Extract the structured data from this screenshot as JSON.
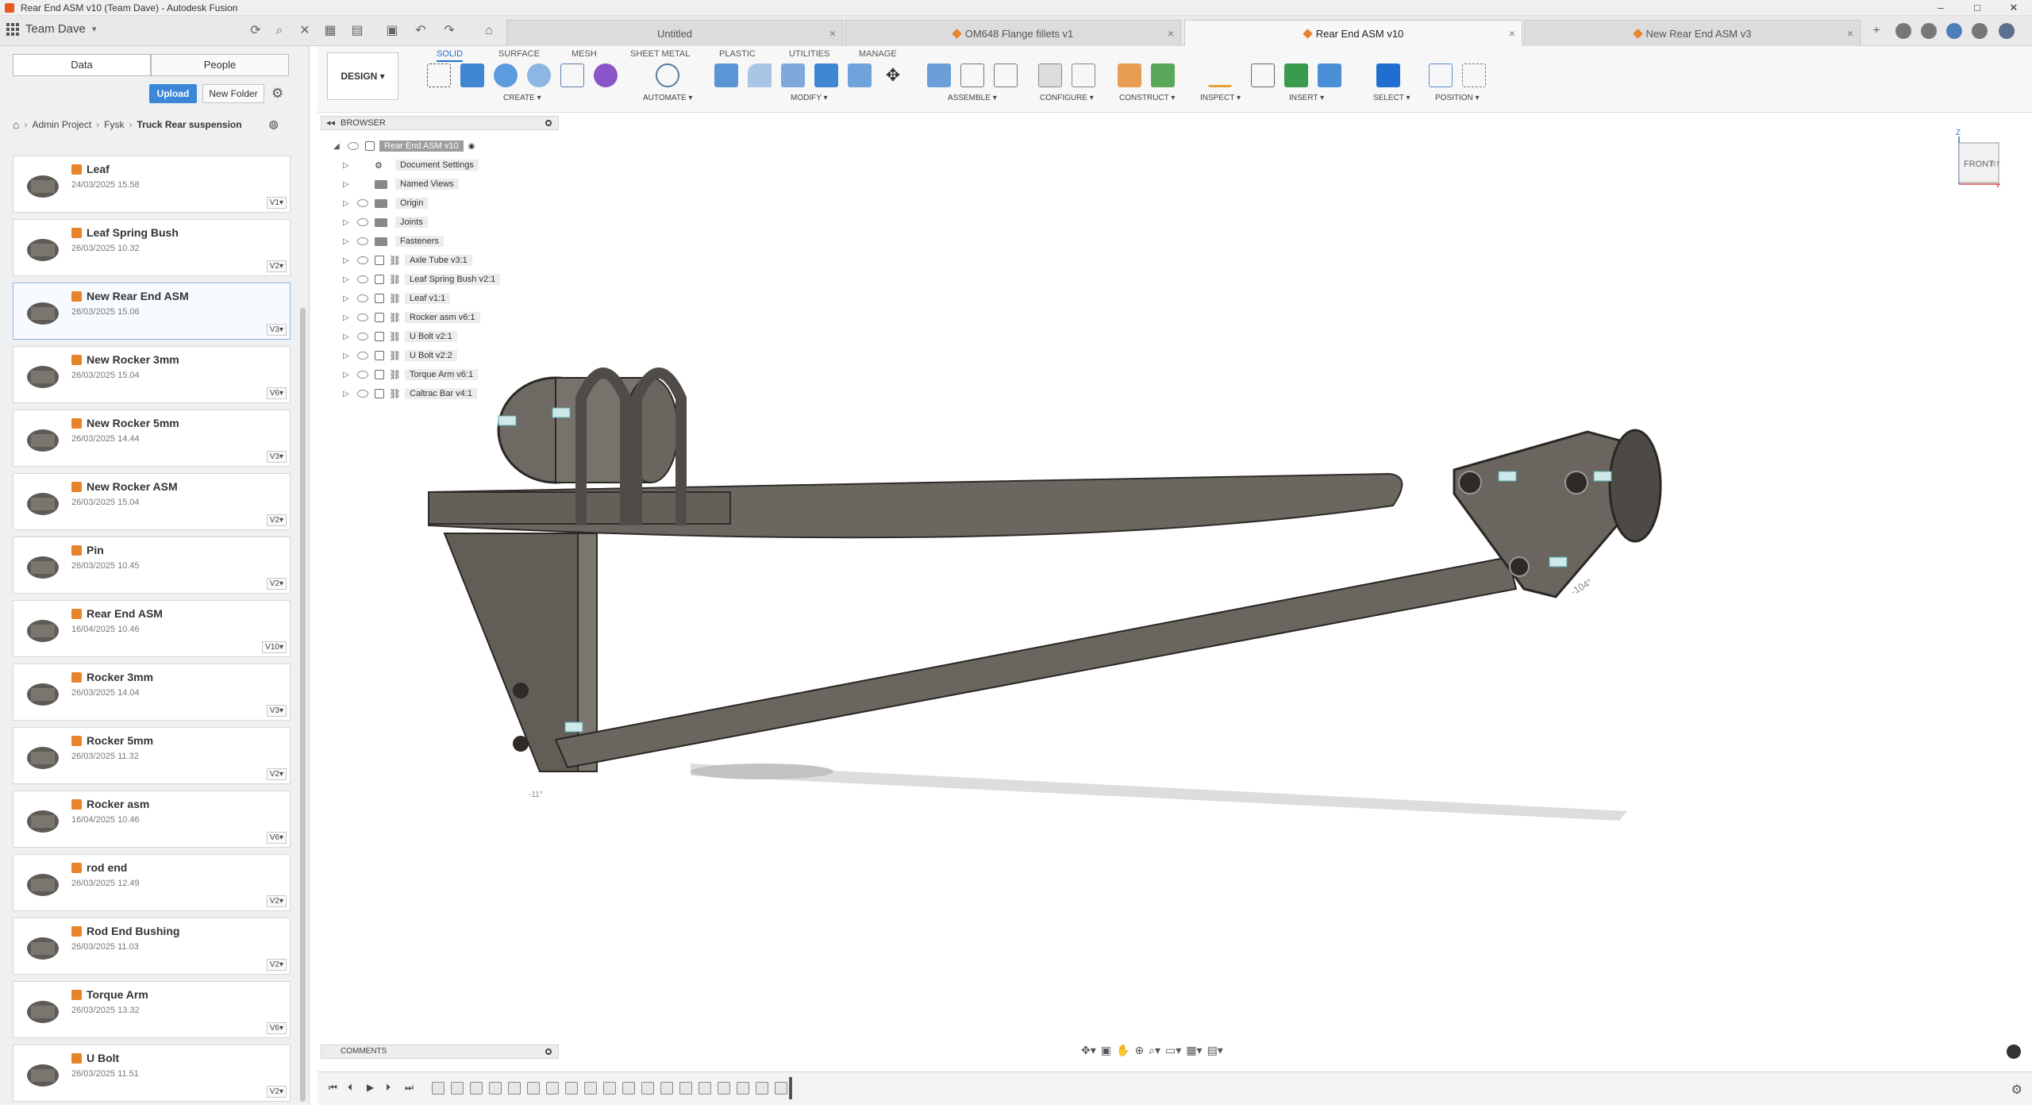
{
  "window": {
    "title": "Rear End ASM v10 (Team Dave) - Autodesk Fusion",
    "controls": [
      "–",
      "□",
      "✕"
    ]
  },
  "appbar": {
    "team": "Team Dave",
    "tabs": [
      {
        "label": "Untitled",
        "active": false
      },
      {
        "label": "OM648 Flange fillets v1",
        "active": false
      },
      {
        "label": "Rear End ASM v10",
        "active": true
      },
      {
        "label": "New Rear End ASM v3",
        "active": false
      }
    ]
  },
  "datapanel": {
    "tab_data": "Data",
    "tab_people": "People",
    "upload": "Upload",
    "new_folder": "New Folder",
    "breadcrumb": [
      "Admin Project",
      "Fysk",
      "Truck Rear suspension"
    ],
    "files": [
      {
        "name": "Leaf",
        "date": "24/03/2025 15.58",
        "version": "V1",
        "icon": "leaf-thumb"
      },
      {
        "name": "Leaf Spring Bush",
        "date": "26/03/2025 10.32",
        "version": "V2",
        "icon": "bush-thumb"
      },
      {
        "name": "New Rear End ASM",
        "date": "26/03/2025 15.06",
        "version": "V3",
        "icon": "assembly-thumb",
        "selected": true
      },
      {
        "name": "New Rocker 3mm",
        "date": "26/03/2025 15.04",
        "version": "V6",
        "icon": "rocker-thumb"
      },
      {
        "name": "New Rocker 5mm",
        "date": "26/03/2025 14.44",
        "version": "V3",
        "icon": "rocker-thumb"
      },
      {
        "name": "New Rocker ASM",
        "date": "26/03/2025 15.04",
        "version": "V2",
        "icon": "rocker-asm-thumb"
      },
      {
        "name": "Pin",
        "date": "26/03/2025 10.45",
        "version": "V2",
        "icon": "pin-thumb"
      },
      {
        "name": "Rear End ASM",
        "date": "16/04/2025 10.46",
        "version": "V10",
        "icon": "assembly-thumb"
      },
      {
        "name": "Rocker 3mm",
        "date": "26/03/2025 14.04",
        "version": "V3",
        "icon": "rocker-thumb"
      },
      {
        "name": "Rocker 5mm",
        "date": "26/03/2025 11.32",
        "version": "V2",
        "icon": "rocker-thumb"
      },
      {
        "name": "Rocker asm",
        "date": "16/04/2025 10.46",
        "version": "V6",
        "icon": "rocker-asm-thumb"
      },
      {
        "name": "rod end",
        "date": "26/03/2025 12.49",
        "version": "V2",
        "icon": "rod-end-thumb"
      },
      {
        "name": "Rod End Bushing",
        "date": "26/03/2025 11.03",
        "version": "V2",
        "icon": "bushing-thumb"
      },
      {
        "name": "Torque Arm",
        "date": "26/03/2025 13.32",
        "version": "V6",
        "icon": "torque-arm-thumb"
      },
      {
        "name": "U Bolt",
        "date": "26/03/2025 11.51",
        "version": "V2",
        "icon": "u-bolt-thumb"
      }
    ]
  },
  "toolbar": {
    "workspace": "DESIGN",
    "ribbon_tabs": [
      "SOLID",
      "SURFACE",
      "MESH",
      "SHEET METAL",
      "PLASTIC",
      "UTILITIES",
      "MANAGE"
    ],
    "groups": [
      "CREATE",
      "AUTOMATE",
      "MODIFY",
      "ASSEMBLE",
      "CONFIGURE",
      "CONSTRUCT",
      "INSPECT",
      "INSERT",
      "SELECT",
      "POSITION"
    ]
  },
  "browser": {
    "title": "BROWSER",
    "root": "Rear End ASM v10",
    "items": [
      {
        "label": "Document Settings",
        "type": "settings"
      },
      {
        "label": "Named Views",
        "type": "folder"
      },
      {
        "label": "Origin",
        "type": "folder"
      },
      {
        "label": "Joints",
        "type": "folder"
      },
      {
        "label": "Fasteners",
        "type": "folder"
      },
      {
        "label": "Axle Tube v3:1",
        "type": "component"
      },
      {
        "label": "Leaf Spring Bush v2:1",
        "type": "component"
      },
      {
        "label": "Leaf v1:1",
        "type": "component"
      },
      {
        "label": "Rocker asm v6:1",
        "type": "component"
      },
      {
        "label": "U Bolt v2:1",
        "type": "component"
      },
      {
        "label": "U Bolt v2:2",
        "type": "component"
      },
      {
        "label": "Torque Arm v6:1",
        "type": "component"
      },
      {
        "label": "Caltrac Bar v4:1",
        "type": "component"
      }
    ]
  },
  "viewcube": {
    "face": "FRONT",
    "side": "RT",
    "axis_z": "Z",
    "axis_x": "X"
  },
  "model": {
    "angle_label_1": "-104°",
    "angle_label_2": "-11°"
  },
  "comments": {
    "title": "COMMENTS"
  },
  "colors": {
    "accent": "#1f6fd1",
    "upload": "#3b86d6",
    "file_badge": "#e8832a",
    "model_metal": "#6b6660"
  }
}
